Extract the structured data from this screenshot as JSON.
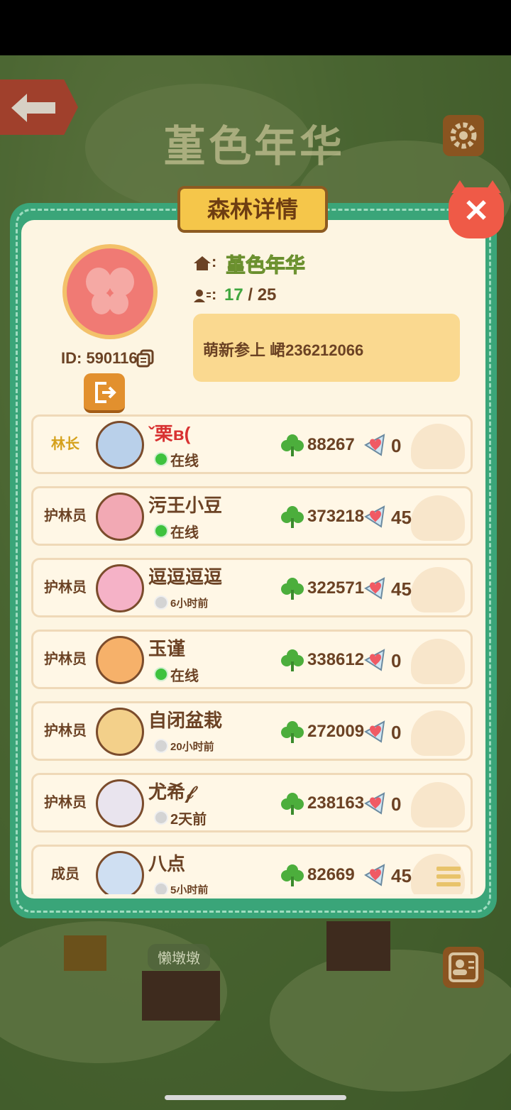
{
  "background": {
    "title": "堇色年华",
    "label": "懒墩墩"
  },
  "panel": {
    "title": "森林详情",
    "guild_name": "堇色年华",
    "member_count": "17",
    "member_max": "/ 25",
    "id_label": "ID: 590116",
    "notice": "萌新参上  峮236212066"
  },
  "members": [
    {
      "role": "林长",
      "name": "ˇ栗ʙ(",
      "status": "在线",
      "online": true,
      "score": "88267",
      "likes": "0",
      "avatar_color": "#b9d0ea"
    },
    {
      "role": "护林员",
      "name": "污王小豆",
      "status": "在线",
      "online": true,
      "score": "373218",
      "likes": "45",
      "avatar_color": "#f2a9b4"
    },
    {
      "role": "护林员",
      "name": "逗逗逗逗",
      "status": "6小时前",
      "online": false,
      "score": "322571",
      "likes": "45",
      "avatar_color": "#f5b2c7"
    },
    {
      "role": "护林员",
      "name": "玉谨",
      "status": "在线",
      "online": true,
      "score": "338612",
      "likes": "0",
      "avatar_color": "#f6b16a"
    },
    {
      "role": "护林员",
      "name": "自闭盆栽",
      "status": "20小时前",
      "online": false,
      "score": "272009",
      "likes": "0",
      "avatar_color": "#f3d08a"
    },
    {
      "role": "护林员",
      "name": "尤希𝒻",
      "status": "2天前",
      "online": false,
      "score": "238163",
      "likes": "0",
      "avatar_color": "#e9e4ee"
    },
    {
      "role": "成员",
      "name": "八点",
      "status": "5小时前",
      "online": false,
      "score": "82669",
      "likes": "45",
      "avatar_color": "#cfdff2"
    }
  ]
}
